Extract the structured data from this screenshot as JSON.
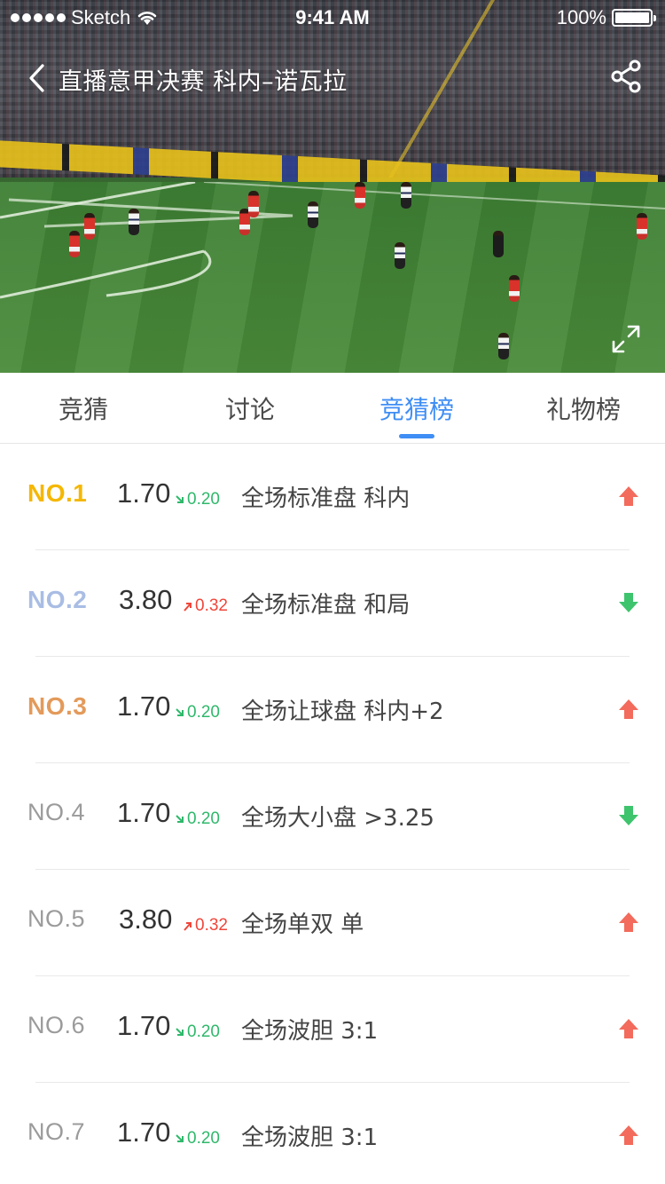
{
  "status_bar": {
    "carrier": "Sketch",
    "time": "9:41 AM",
    "battery": "100%"
  },
  "nav": {
    "title": "直播意甲决赛 科内–诺瓦拉",
    "back_icon": "chevron-left-icon",
    "share_icon": "share-icon",
    "fullscreen_icon": "fullscreen-icon"
  },
  "tabs": [
    {
      "label": "竞猜",
      "active": false
    },
    {
      "label": "讨论",
      "active": false
    },
    {
      "label": "竞猜榜",
      "active": true
    },
    {
      "label": "礼物榜",
      "active": false
    }
  ],
  "colors": {
    "accent": "#3f8ef5",
    "gold": "#f5b700",
    "silver": "#a9bde4",
    "bronze": "#e39a5a",
    "gray_rank": "#9b9b9b",
    "change_down": "#2fb86b",
    "change_up": "#f0463a",
    "trend_up": "#f36b5c",
    "trend_down": "#3ec46d"
  },
  "ranking": [
    {
      "rank": "NO.1",
      "odds": "1.70",
      "change": "0.20",
      "change_dir": "down",
      "desc": "全场标准盘 科内",
      "trend": "up"
    },
    {
      "rank": "NO.2",
      "odds": "3.80",
      "change": "0.32",
      "change_dir": "up",
      "desc": "全场标准盘 和局",
      "trend": "down"
    },
    {
      "rank": "NO.3",
      "odds": "1.70",
      "change": "0.20",
      "change_dir": "down",
      "desc": "全场让球盘 科内+2",
      "trend": "up"
    },
    {
      "rank": "NO.4",
      "odds": "1.70",
      "change": "0.20",
      "change_dir": "down",
      "desc": "全场大小盘 >3.25",
      "trend": "down"
    },
    {
      "rank": "NO.5",
      "odds": "3.80",
      "change": "0.32",
      "change_dir": "up",
      "desc": "全场单双 单",
      "trend": "up"
    },
    {
      "rank": "NO.6",
      "odds": "1.70",
      "change": "0.20",
      "change_dir": "down",
      "desc": "全场波胆 3:1",
      "trend": "up"
    },
    {
      "rank": "NO.7",
      "odds": "1.70",
      "change": "0.20",
      "change_dir": "down",
      "desc": "全场波胆 3:1",
      "trend": "up"
    }
  ]
}
